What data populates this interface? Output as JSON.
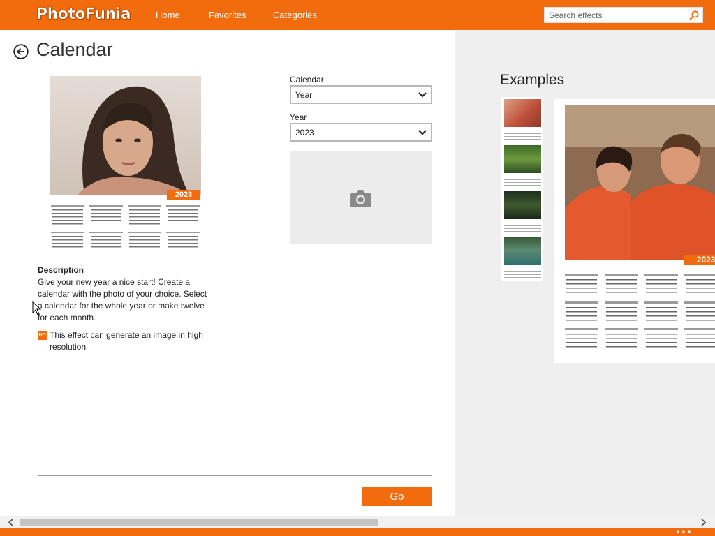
{
  "app": {
    "logo_text": "PhotoFunia",
    "nav": [
      "Home",
      "Favorites",
      "Categories"
    ],
    "search_placeholder": "Search effects"
  },
  "page": {
    "title": "Calendar",
    "preview_year_badge": "2023",
    "description_heading": "Description",
    "description": "Give your new year a nice start! Create a calendar with the photo of your choice. Select a calendar for the whole year or make twelve for each month.",
    "hd_badge": "HD",
    "hd_note": "This effect can generate an image in high resolution"
  },
  "form": {
    "calendar_label": "Calendar",
    "calendar_value": "Year",
    "year_label": "Year",
    "year_value": "2023",
    "go_label": "Go"
  },
  "examples": {
    "heading": "Examples",
    "big_year_badge": "2023"
  },
  "colors": {
    "accent": "#f26b0c",
    "panel": "#efefef",
    "upload_bg": "#ececec"
  }
}
